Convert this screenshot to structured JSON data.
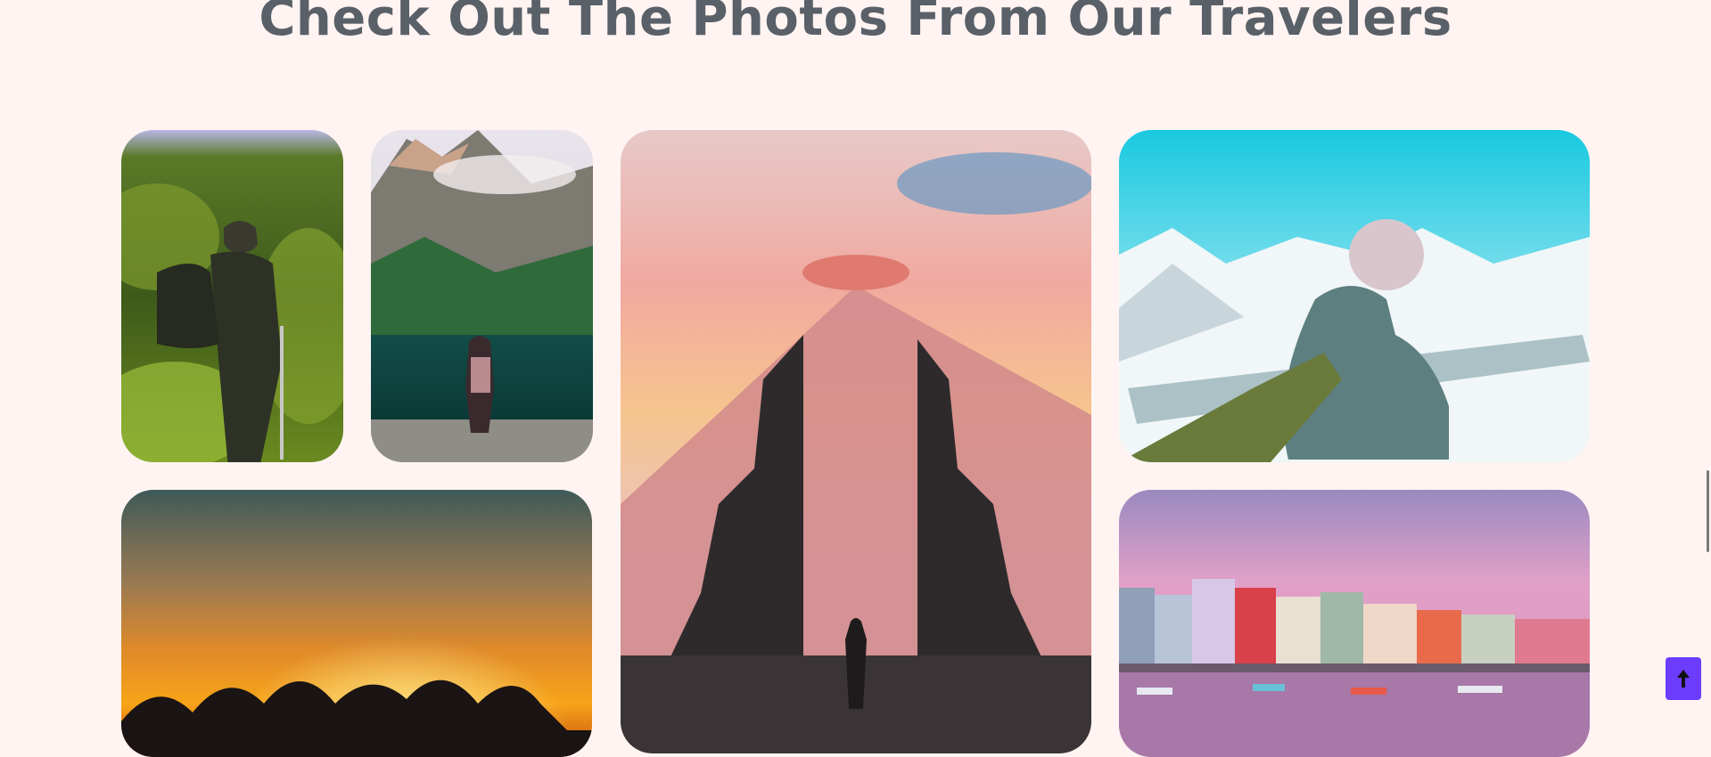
{
  "gallery": {
    "title": "Check Out The Photos From Our Travelers",
    "photos": [
      {
        "icon": "hiker-forest-photo"
      },
      {
        "icon": "woman-mountain-lake-photo"
      },
      {
        "icon": "temple-gate-volcano-photo"
      },
      {
        "icon": "snow-mountain-hand-photo"
      },
      {
        "icon": "sunset-silhouettes-photo"
      },
      {
        "icon": "harbor-town-photo"
      }
    ]
  },
  "colors": {
    "background": "#fff4f2",
    "heading": "#5a6068",
    "accent": "#6c3cff"
  },
  "controls": {
    "scroll_top_icon": "arrow-up-icon"
  }
}
